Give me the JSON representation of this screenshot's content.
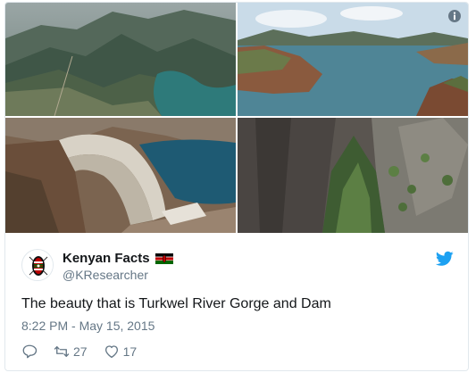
{
  "tweet": {
    "author": {
      "display_name": "Kenyan Facts",
      "handle": "@KResearcher",
      "avatar_icon": "kenya-emblem-icon",
      "flag_icon": "kenya-flag-icon"
    },
    "text": "The beauty that is Turkwel River Gorge and Dam",
    "timestamp": "8:22 PM - May 15, 2015",
    "stats": {
      "replies_icon": "reply-icon",
      "retweets": "27",
      "likes": "17"
    },
    "media": [
      {
        "subject": "mountain-valley-lake"
      },
      {
        "subject": "reservoir-lake"
      },
      {
        "subject": "dam-wall"
      },
      {
        "subject": "river-gorge"
      }
    ]
  },
  "colors": {
    "accent": "#1da1f2",
    "text": "#14171a",
    "muted": "#657786",
    "border": "#e1e8ed"
  }
}
